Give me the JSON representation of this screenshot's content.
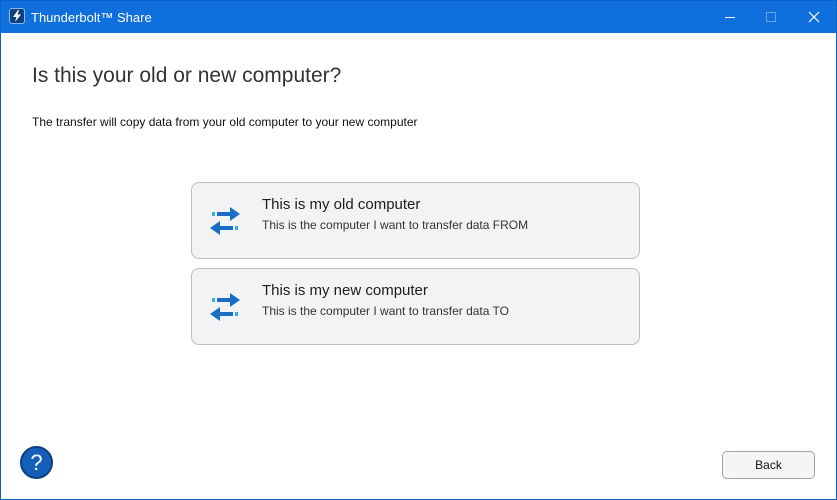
{
  "window": {
    "title": "Thunderbolt™ Share",
    "icons": {
      "app": "thunderbolt-app-icon",
      "minimize": "minimize-icon",
      "maximize": "maximize-icon",
      "close": "close-icon"
    },
    "colors": {
      "titlebar": "#0f6fdc",
      "accent": "#1a6fc4",
      "arrow_light": "#3fa9e6"
    }
  },
  "main": {
    "heading": "Is this your old or new computer?",
    "subtext": "The transfer will copy data from your old computer to your new computer",
    "options": [
      {
        "title": "This is my old computer",
        "description": "This is the computer I want to transfer data FROM",
        "icon": "transfer-arrows-icon"
      },
      {
        "title": "This is my new computer",
        "description": "This is the computer I want to transfer data TO",
        "icon": "transfer-arrows-icon"
      }
    ]
  },
  "footer": {
    "help_label": "?",
    "back_label": "Back"
  }
}
